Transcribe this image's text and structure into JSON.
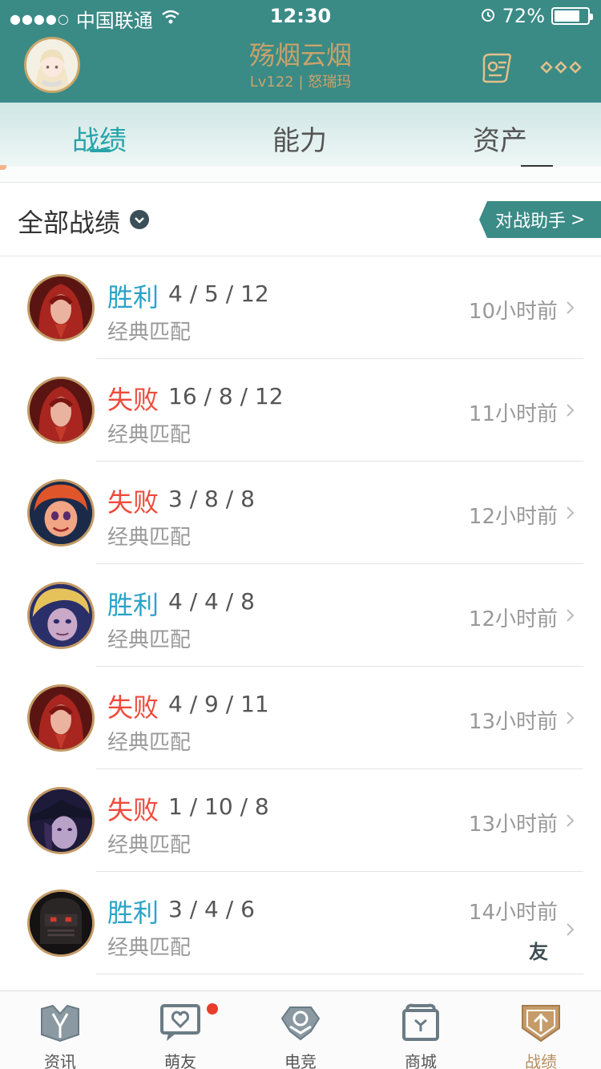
{
  "status_bar": {
    "signal": "●●●●○",
    "carrier": "中国联通",
    "time": "12:30",
    "battery": "72%"
  },
  "profile": {
    "name": "殇烟云烟",
    "level": "Lv122",
    "server": "怒瑞玛",
    "separator": "|"
  },
  "tabs": [
    {
      "label": "战绩",
      "active": true
    },
    {
      "label": "能力",
      "active": false
    },
    {
      "label": "资产",
      "active": false
    }
  ],
  "filter": {
    "title": "全部战绩",
    "assistant_button": "对战助手",
    "assistant_arrow": ">"
  },
  "matches": [
    {
      "result": "胜利",
      "outcome": "win",
      "kda": "4 / 5 / 12",
      "mode": "经典匹配",
      "time": "10小时前",
      "champion_icon": "red-hooded-champion-icon"
    },
    {
      "result": "失败",
      "outcome": "loss",
      "kda": "16 / 8 / 12",
      "mode": "经典匹配",
      "time": "11小时前",
      "champion_icon": "red-hooded-champion-icon"
    },
    {
      "result": "失败",
      "outcome": "loss",
      "kda": "3 / 8 / 8",
      "mode": "经典匹配",
      "time": "12小时前",
      "champion_icon": "red-hair-champion-icon"
    },
    {
      "result": "胜利",
      "outcome": "win",
      "kda": "4 / 4 / 8",
      "mode": "经典匹配",
      "time": "12小时前",
      "champion_icon": "blonde-champion-icon"
    },
    {
      "result": "失败",
      "outcome": "loss",
      "kda": "4 / 9 / 11",
      "mode": "经典匹配",
      "time": "13小时前",
      "champion_icon": "red-hooded-champion-icon"
    },
    {
      "result": "失败",
      "outcome": "loss",
      "kda": "1 / 10 / 8",
      "mode": "经典匹配",
      "time": "13小时前",
      "champion_icon": "hat-champion-icon"
    },
    {
      "result": "胜利",
      "outcome": "win",
      "kda": "3 / 4 / 6",
      "mode": "经典匹配",
      "time": "14小时前",
      "champion_icon": "armored-champion-icon"
    }
  ],
  "friend_float": "友",
  "bottom_nav": [
    {
      "label": "资讯",
      "icon": "news-icon",
      "active": false
    },
    {
      "label": "萌友",
      "icon": "friends-icon",
      "active": false
    },
    {
      "label": "电竞",
      "icon": "esports-icon",
      "active": false
    },
    {
      "label": "商城",
      "icon": "store-icon",
      "active": false
    },
    {
      "label": "战绩",
      "icon": "record-icon",
      "active": true
    }
  ],
  "colors": {
    "header": "#3a8a86",
    "accent": "#26a4a9",
    "win": "#2aa3c8",
    "loss": "#ee4b3b",
    "gold": "#c9a36b"
  }
}
